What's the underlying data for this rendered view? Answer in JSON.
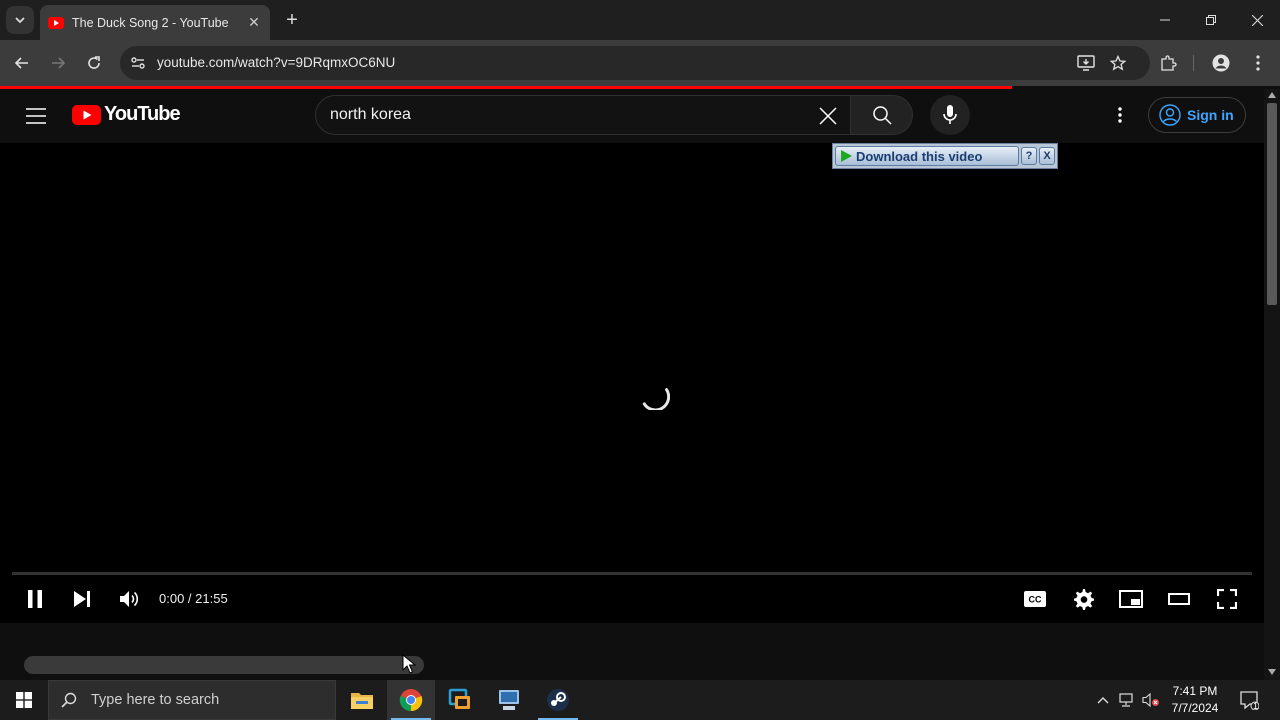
{
  "browser": {
    "tab": {
      "title": "The Duck Song 2 - YouTube"
    },
    "url": "youtube.com/watch?v=9DRqmxOC6NU"
  },
  "youtube": {
    "logo_text": "YouTube",
    "search": {
      "value": "north korea"
    },
    "sign_in_label": "Sign in"
  },
  "download_bar": {
    "label": "Download this video",
    "help_label": "?",
    "close_label": "X"
  },
  "player": {
    "time": "0:00 / 21:55",
    "state": "loading",
    "progress_fraction": 0.0
  },
  "taskbar": {
    "search_placeholder": "Type here to search",
    "clock_time": "7:41 PM",
    "clock_date": "7/7/2024",
    "notification_count": "1"
  },
  "colors": {
    "yt_red": "#ff0000",
    "link_blue": "#3ea6ff",
    "taskbar_accent": "#76b9ed"
  }
}
